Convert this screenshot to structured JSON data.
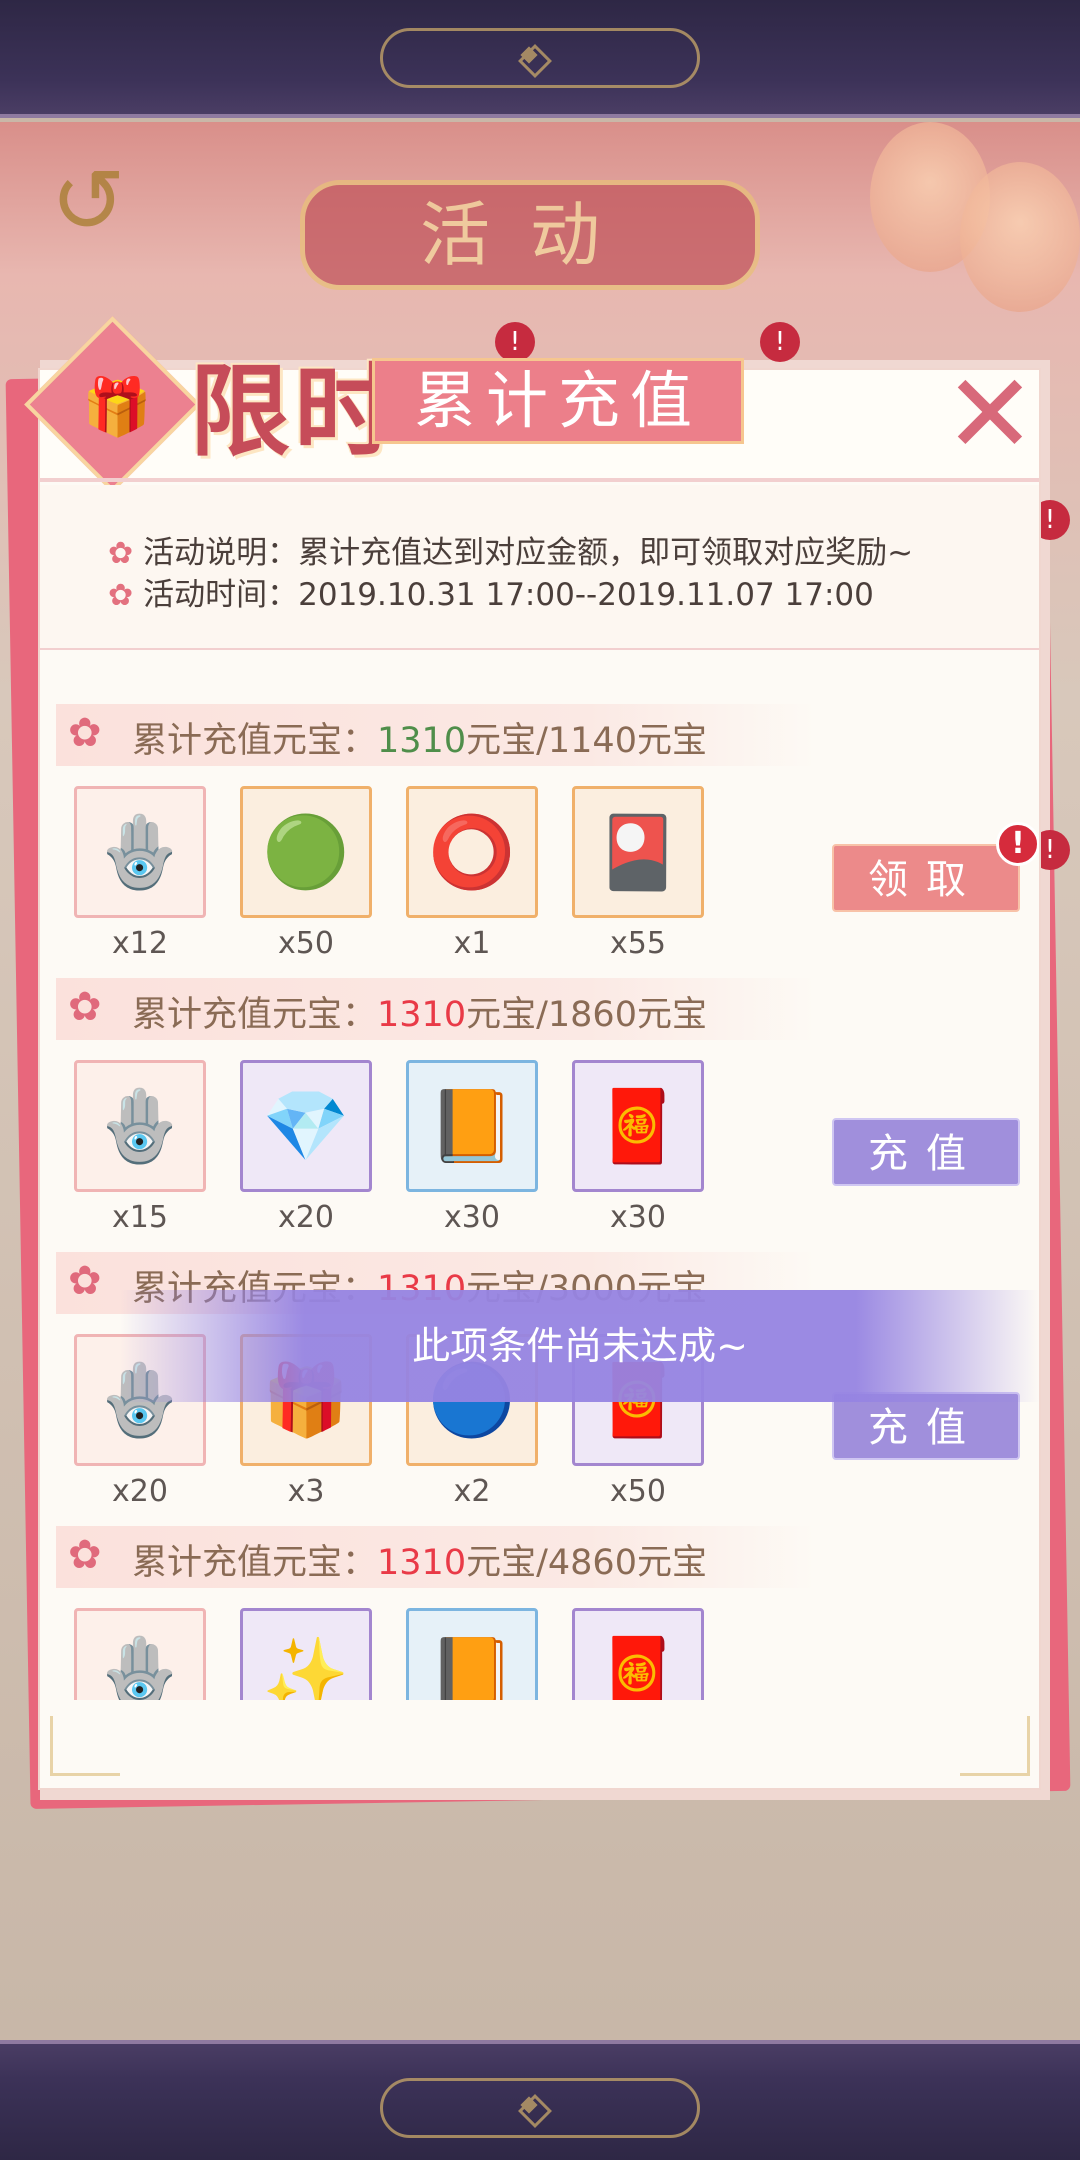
{
  "background": {
    "back_icon": "back-arrow-icon",
    "title": "活动"
  },
  "dialog": {
    "title_main": "限时",
    "title_sub": "累计充值",
    "close_icon": "close-icon",
    "gift_icon": "gift-icon",
    "description": {
      "label1": "活动说明：",
      "text1": "累计充值达到对应金额，即可领取对应奖励~",
      "label2": "活动时间：",
      "text2": "2019.10.31 17:00--2019.11.07 17:00"
    },
    "tiers": [
      {
        "label": "累计充值元宝：",
        "current": "1310",
        "target": "元宝/1140元宝",
        "achieved": true,
        "button": "领取",
        "badge": "!",
        "items": [
          {
            "icon": "jade-pendant",
            "qty": "x12"
          },
          {
            "icon": "green-orb-charm",
            "qty": "x50"
          },
          {
            "icon": "pink-bracelet",
            "qty": "x1"
          },
          {
            "icon": "event-card",
            "qty": "x55"
          }
        ]
      },
      {
        "label": "累计充值元宝：",
        "current": "1310",
        "target": "元宝/1860元宝",
        "achieved": false,
        "button": "充值",
        "items": [
          {
            "icon": "jade-pendant",
            "qty": "x15"
          },
          {
            "icon": "purple-crystal",
            "qty": "x20"
          },
          {
            "icon": "orange-book",
            "qty": "x30"
          },
          {
            "icon": "red-envelope-gui",
            "qty": "x30"
          }
        ]
      },
      {
        "label": "累计充值元宝：",
        "current": "1310",
        "target": "元宝/3000元宝",
        "achieved": false,
        "button": "充值",
        "items": [
          {
            "icon": "jade-pendant",
            "qty": "x20"
          },
          {
            "icon": "gift-box",
            "qty": "x3"
          },
          {
            "icon": "jade-ring-pendant",
            "qty": "x2"
          },
          {
            "icon": "red-envelope-gui",
            "qty": "x50"
          }
        ]
      },
      {
        "label": "累计充值元宝：",
        "current": "1310",
        "target": "元宝/4860元宝",
        "achieved": false,
        "items": [
          {
            "icon": "jade-pendant",
            "qty": ""
          },
          {
            "icon": "awaken-item",
            "qty": ""
          },
          {
            "icon": "orange-book",
            "qty": ""
          },
          {
            "icon": "red-envelope-gui",
            "qty": ""
          }
        ]
      }
    ],
    "toast": "此项条件尚未达成~"
  },
  "colors": {
    "achieved": "#4f8e4a",
    "not_achieved": "#e93a47",
    "claim_button": "#ec8a8a",
    "charge_button": "#a08fdc"
  }
}
